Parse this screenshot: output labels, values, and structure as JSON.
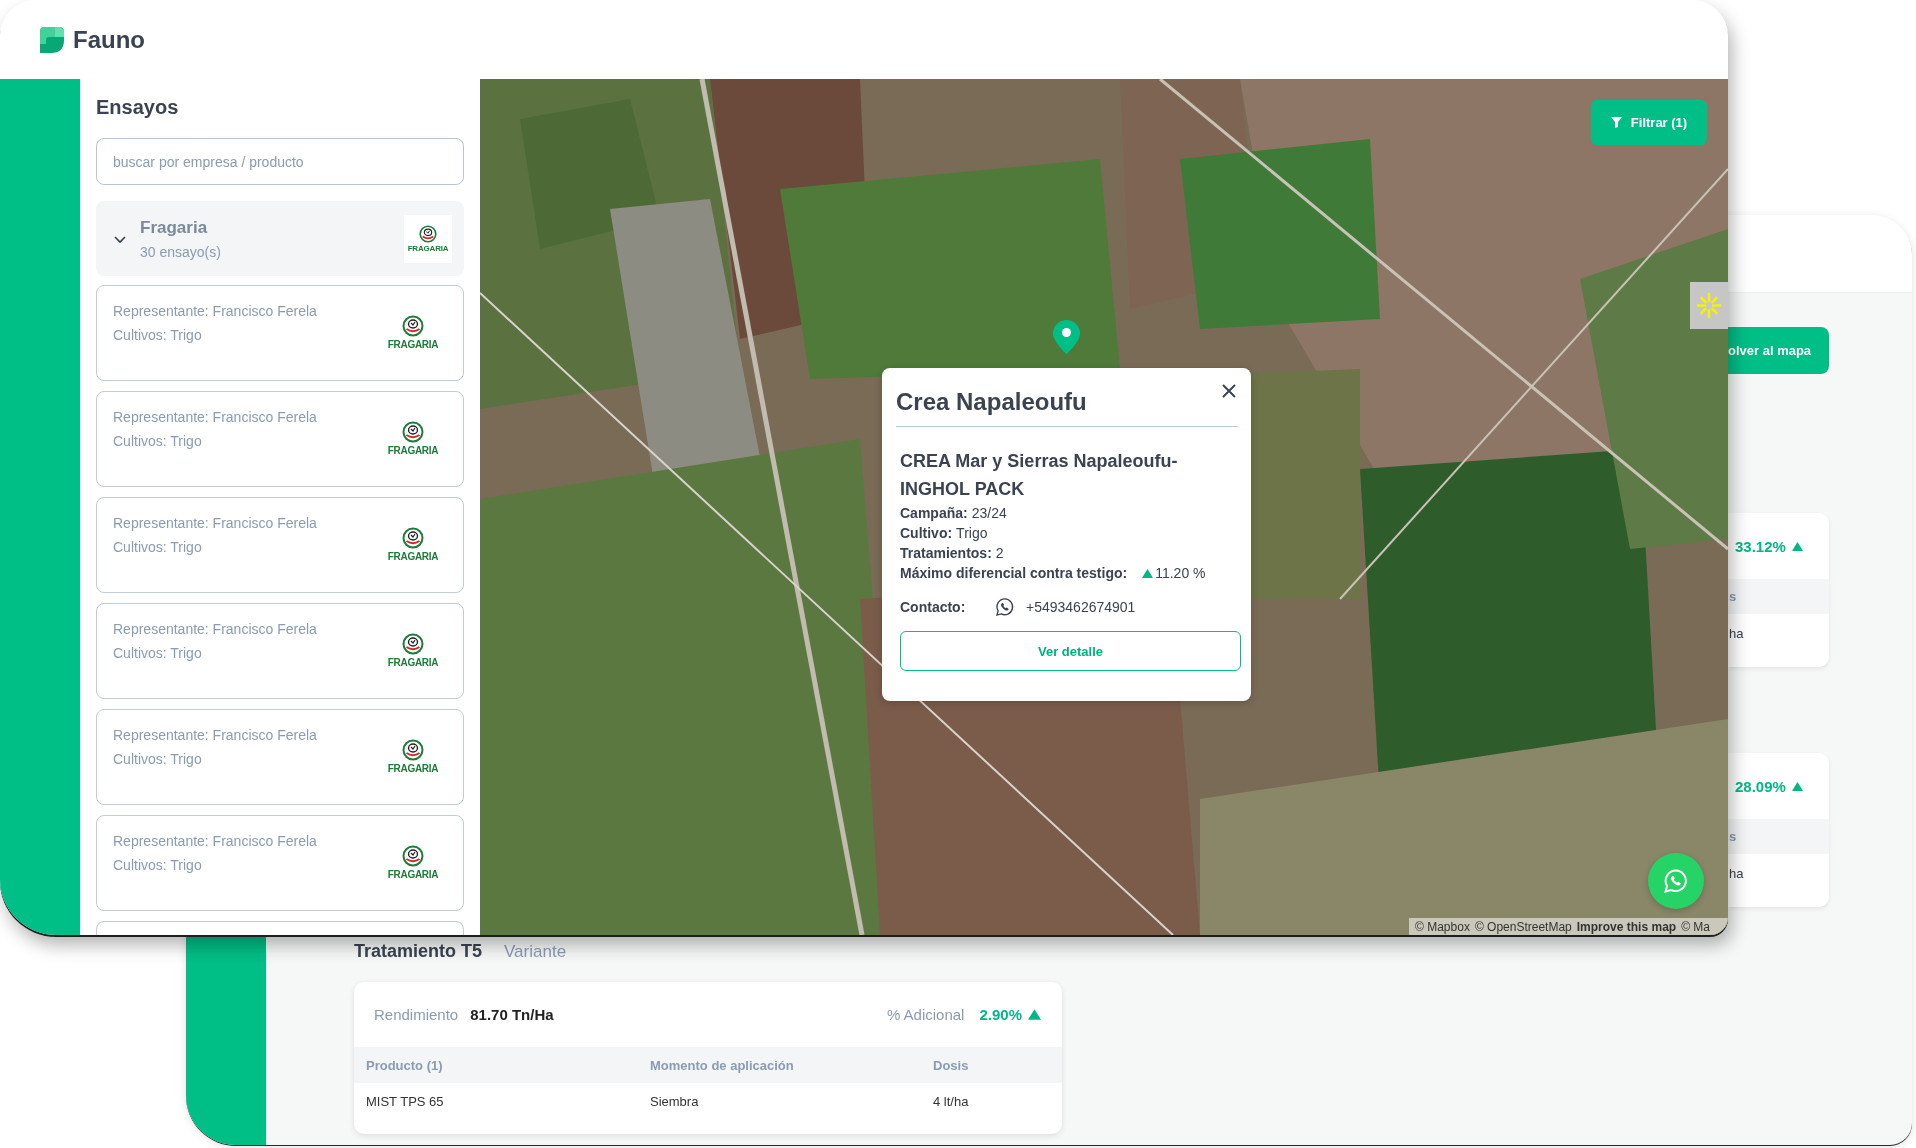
{
  "front_window": {
    "app_name": "Fauno",
    "sidebar": {
      "title": "Ensayos",
      "search": {
        "placeholder": "buscar por empresa / producto"
      },
      "group": {
        "name": "Fragaria",
        "count": "30 ensayo(s)",
        "expanded": true,
        "logo_text": "FRAGARIA"
      },
      "cards": [
        {
          "representative": "Representante: Francisco Ferela",
          "crops": "Cultivos: Trigo",
          "logo_text": "FRAGARIA"
        },
        {
          "representative": "Representante: Francisco Ferela",
          "crops": "Cultivos: Trigo",
          "logo_text": "FRAGARIA"
        },
        {
          "representative": "Representante: Francisco Ferela",
          "crops": "Cultivos: Trigo",
          "logo_text": "FRAGARIA"
        },
        {
          "representative": "Representante: Francisco Ferela",
          "crops": "Cultivos: Trigo",
          "logo_text": "FRAGARIA"
        },
        {
          "representative": "Representante: Francisco Ferela",
          "crops": "Cultivos: Trigo",
          "logo_text": "FRAGARIA"
        },
        {
          "representative": "Representante: Francisco Ferela",
          "crops": "Cultivos: Trigo",
          "logo_text": "FRAGARIA"
        }
      ]
    },
    "map": {
      "filter_button": "Filtrar (1)",
      "popup": {
        "title": "Crea Napaleoufu",
        "subtitle": "CREA Mar y Sierras Napaleoufu-INGHOL PACK",
        "fields": [
          {
            "label": "Campaña:",
            "value": "23/24"
          },
          {
            "label": "Cultivo:",
            "value": "Trigo"
          },
          {
            "label": "Tratamientos:",
            "value": "2"
          },
          {
            "label": "Máximo diferencial contra testigo:",
            "value": "11.20 %",
            "increase": true
          }
        ],
        "contact": {
          "label": "Contacto:",
          "phone": "+5493462674901"
        },
        "button": "Ver detalle"
      },
      "attribution": [
        {
          "kind": "credit",
          "text": "© Mapbox"
        },
        {
          "kind": "credit",
          "text": "© OpenStreetMap"
        },
        {
          "kind": "link",
          "text": "Improve this map"
        },
        {
          "kind": "credit",
          "text": "© Ma"
        }
      ]
    }
  },
  "back_window": {
    "back_button": "olver al mapa",
    "summary_cards": [
      {
        "percent": "33.12%",
        "increase": true,
        "column_fragment": "s",
        "cell_fragment": "ha"
      },
      {
        "percent": "28.09%",
        "increase": true,
        "column_fragment": "s",
        "cell_fragment": "ha"
      }
    ],
    "treatment": {
      "title": "Tratamiento T5",
      "tag": "Variante",
      "yield_label": "Rendimiento",
      "yield_value": "81.70 Tn/Ha",
      "extra_label": "% Adicional",
      "extra_value": "2.90%",
      "increase": true,
      "table": {
        "columns": [
          "Producto (1)",
          "Momento de aplicación",
          "Dosis"
        ],
        "rows": [
          [
            "MIST TPS 65",
            "Siembra",
            "4 lt/ha"
          ]
        ]
      }
    }
  }
}
